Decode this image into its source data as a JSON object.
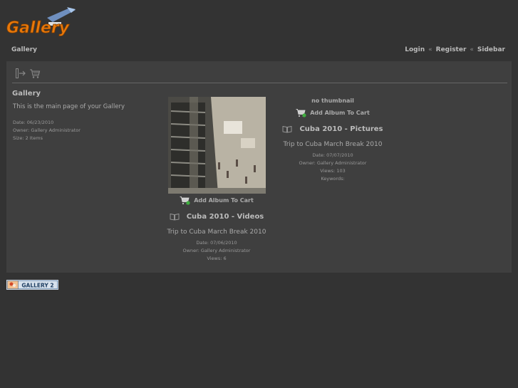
{
  "logo": {
    "text": "Gallery"
  },
  "topbar": {
    "breadcrumb": "Gallery",
    "links": {
      "login": "Login",
      "register": "Register",
      "sidebar": "Sidebar"
    },
    "separator": "«"
  },
  "toolbar": {
    "icons": [
      "exit-icon",
      "cart-icon"
    ]
  },
  "sidebar": {
    "title": "Gallery",
    "description": "This is the main page of your Gallery",
    "meta": [
      "Date: 06/23/2010",
      "Owner: Gallery Administrator",
      "Size: 2 Items"
    ]
  },
  "albums": [
    {
      "cart_label": "Add Album To Cart",
      "title": "Cuba 2010 - Videos",
      "description": "Trip to Cuba March Break 2010",
      "meta": [
        "Date: 07/06/2010",
        "Owner: Gallery Administrator",
        "Views: 6"
      ]
    },
    {
      "thumb_text": "no thumbnail",
      "cart_label": "Add Album To Cart",
      "title": "Cuba 2010 - Pictures",
      "description": "Trip to Cuba March Break 2010",
      "meta": [
        "Date: 07/07/2010",
        "Owner: Gallery Administrator",
        "Views: 103",
        "Keywords:"
      ]
    }
  ],
  "footer": {
    "badge": "GALLERY 2"
  },
  "colors": {
    "background": "#333333",
    "panel": "#3f3f3f",
    "logo_orange": "#e8780a",
    "link": "#bbbbbb"
  }
}
